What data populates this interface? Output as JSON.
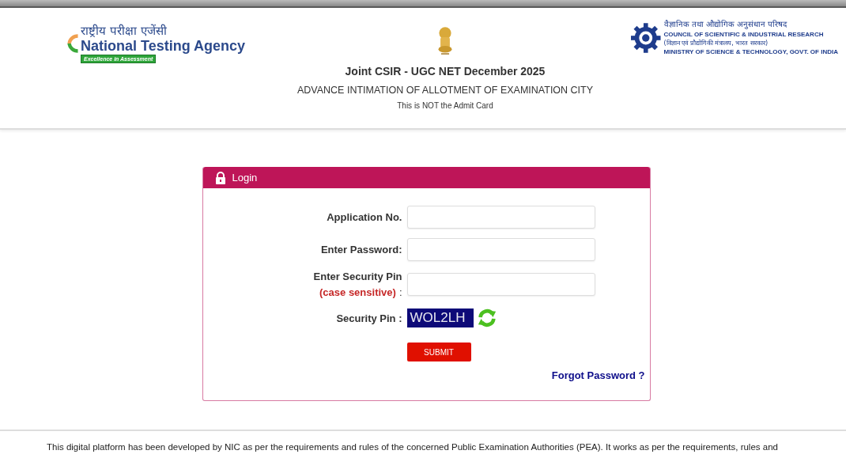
{
  "header": {
    "left_logo": {
      "hindi": "राष्ट्रीय परीक्षा एजेंसी",
      "name": "National Testing Agency",
      "tagline": "Excellence in Assessment"
    },
    "title": "Joint CSIR - UGC NET December 2025",
    "subtitle": "ADVANCE INTIMATION OF ALLOTMENT OF EXAMINATION CITY",
    "note": "This is NOT the Admit Card",
    "right_logo": {
      "hindi": "वैज्ञानिक तथा औद्योगिक अनुसंधान परिषद",
      "name": "COUNCIL OF SCIENTIFIC & INDUSTRIAL RESEARCH",
      "hindi_ministry": "(विज्ञान एवं प्रौद्योगिकी मंत्रालय, भारत सरकार)",
      "ministry": "MINISTRY OF SCIENCE & TECHNOLOGY, GOVT. OF INDIA"
    }
  },
  "login": {
    "title": "Login",
    "fields": [
      {
        "label": "Application No."
      },
      {
        "label": "Enter Password:"
      },
      {
        "label": "Enter Security Pin",
        "hint": "(case sensitive)",
        "suffix": ":"
      }
    ],
    "captcha": {
      "label": "Security Pin :",
      "code": "WOL2LH"
    },
    "submit": "SUBMIT",
    "forgot": "Forgot Password ?"
  },
  "footer": {
    "text": "This digital platform has been developed by NIC as per the requirements and rules of the concerned Public Examination Authorities (PEA). It works as per the requirements, rules and"
  }
}
